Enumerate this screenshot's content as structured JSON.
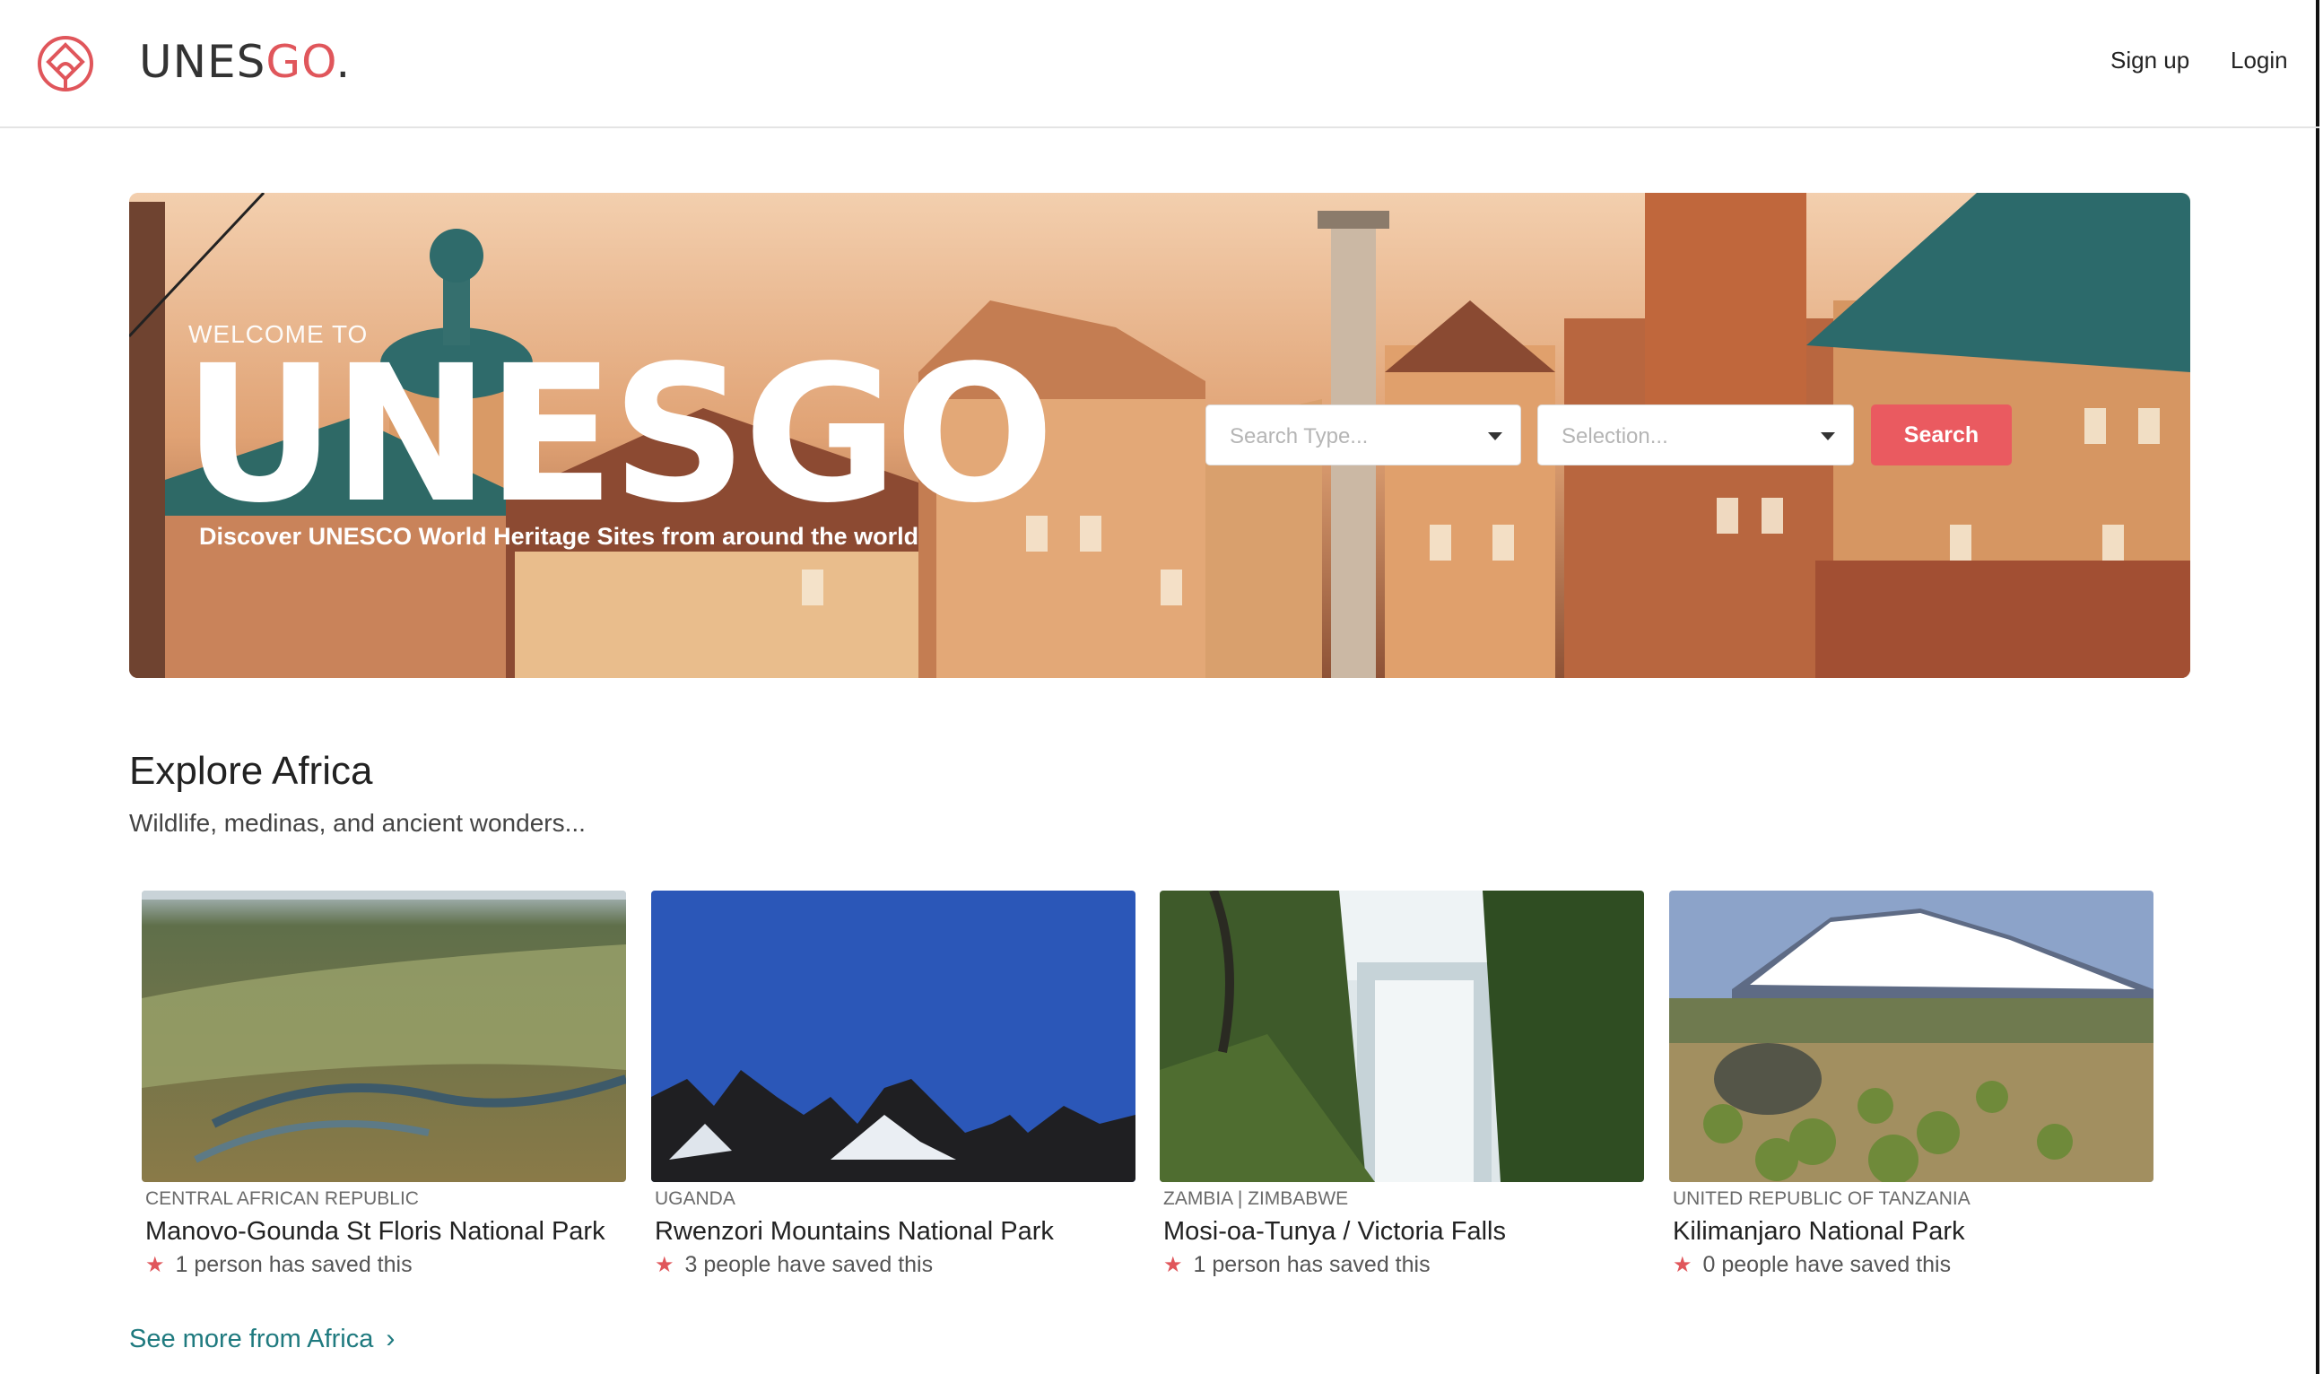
{
  "header": {
    "brand_main": "UNES",
    "brand_accent": "GO",
    "brand_dot": ".",
    "nav": {
      "signup": "Sign up",
      "login": "Login"
    }
  },
  "hero": {
    "welcome": "WELCOME TO",
    "title": "UNESGO",
    "subtitle": "Discover UNESCO World Heritage Sites from around the world",
    "search_type_placeholder": "Search Type...",
    "selection_placeholder": "Selection...",
    "search_button": "Search"
  },
  "section": {
    "title": "Explore Africa",
    "subtitle": "Wildlife, medinas, and ancient wonders...",
    "see_more": "See more from Africa"
  },
  "cards": [
    {
      "country": "CENTRAL AFRICAN REPUBLIC",
      "name": "Manovo-Gounda St Floris National Park",
      "saved": "1 person has saved this"
    },
    {
      "country": "UGANDA",
      "name": "Rwenzori Mountains National Park",
      "saved": "3 people have saved this"
    },
    {
      "country": "ZAMBIA | ZIMBABWE",
      "name": "Mosi-oa-Tunya / Victoria Falls",
      "saved": "1 person has saved this"
    },
    {
      "country": "UNITED REPUBLIC OF TANZANIA",
      "name": "Kilimanjaro National Park",
      "saved": "0 people have saved this"
    }
  ],
  "colors": {
    "accent": "#e0565b",
    "button": "#ea5a60",
    "link": "#1f7a7f"
  }
}
